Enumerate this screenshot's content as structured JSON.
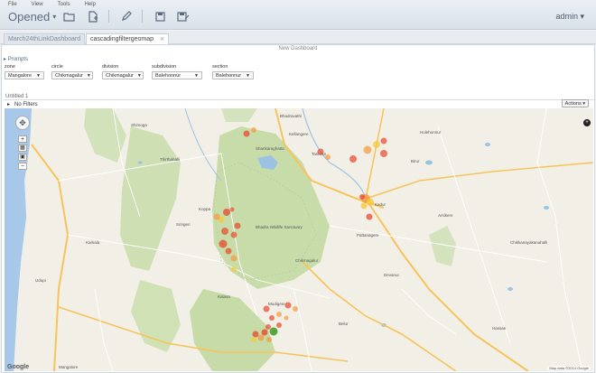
{
  "header": {
    "menu": [
      "File",
      "View",
      "Tools",
      "Help"
    ],
    "opened_label": "Opened",
    "user_label": "admin"
  },
  "tabs": [
    {
      "label": "March24thLinkDashboard",
      "active": false
    },
    {
      "label": "cascadingfiltergeomap",
      "active": true
    }
  ],
  "dashboard": {
    "title": "New Dashboard",
    "prompts_label": "Prompts",
    "prompts": [
      {
        "label": "zone",
        "value": "Mangalore"
      },
      {
        "label": "circle",
        "value": "Chikmagalur"
      },
      {
        "label": "division",
        "value": "Chikmagalur"
      },
      {
        "label": "subdivision",
        "value": "Balehonnur"
      },
      {
        "label": "section",
        "value": "Balehonnur"
      }
    ],
    "panel_title": "Untitled 1",
    "filters_label": "No Filters",
    "actions_label": "Actions"
  },
  "map": {
    "provider": "Google",
    "credit": "Map data ©2014 Google",
    "places": [
      "Bhadravathi",
      "Holehonnur",
      "Shankaraghatta",
      "Kellangere",
      "Thirthahalli",
      "Koppa",
      "Bhadra Wildlife Sanctuary",
      "Chikmagalur",
      "Pattanagere",
      "Tarikere",
      "Udupi",
      "Mangalore",
      "Karkala",
      "Mudigere",
      "Devanur",
      "Kadur",
      "Belur",
      "Hassan",
      "Sringeri",
      "Kalasa",
      "Birur",
      "Chikkanayakanahalli",
      "Arsikere",
      "Shimoga"
    ]
  },
  "colors": {
    "marker_red": "#e8472b",
    "marker_orange": "#f59a3c",
    "marker_yellow": "#f8c93a",
    "marker_green": "#3c9a1e",
    "forest": "#c9dcaa",
    "water": "#9cc2e3",
    "road_major": "#f6c45a"
  }
}
